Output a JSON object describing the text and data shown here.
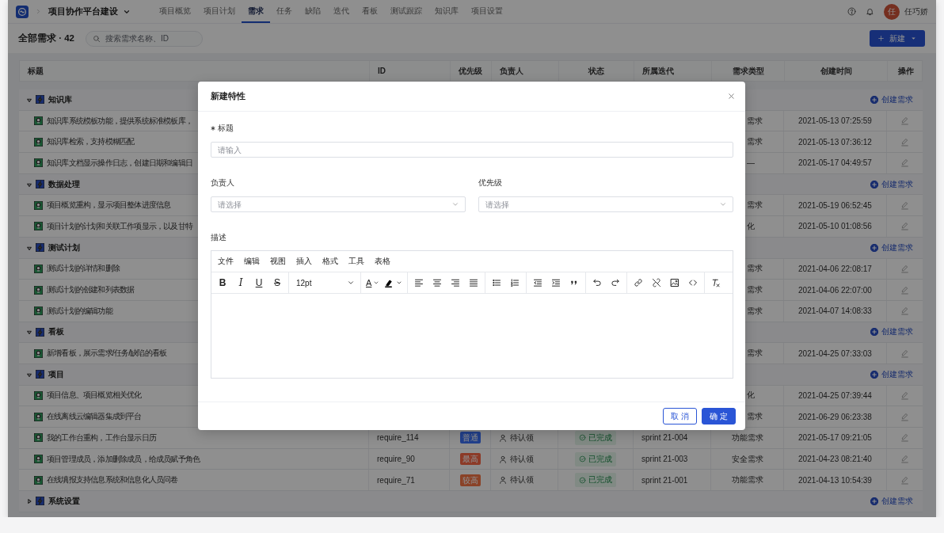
{
  "top_nav": {
    "project": "项目协作平台建设",
    "tabs": [
      {
        "label": "项目概览",
        "selected": false
      },
      {
        "label": "项目计划",
        "selected": false
      },
      {
        "label": "需求",
        "selected": true
      },
      {
        "label": "任务",
        "selected": false
      },
      {
        "label": "缺陷",
        "selected": false
      },
      {
        "label": "迭代",
        "selected": false
      },
      {
        "label": "看板",
        "selected": false
      },
      {
        "label": "测试跟踪",
        "selected": false
      },
      {
        "label": "知识库",
        "selected": false
      },
      {
        "label": "项目设置",
        "selected": false
      }
    ],
    "user": {
      "avatar_text": "任",
      "name": "任巧娇"
    }
  },
  "page_header": {
    "title": "全部需求 · 42",
    "search": {
      "placeholder": "搜索需求名称、ID"
    },
    "new_button": "新建"
  },
  "table": {
    "columns": [
      "标题",
      "ID",
      "优先级",
      "负责人",
      "状态",
      "所属迭代",
      "需求类型",
      "创建时间",
      "操作"
    ],
    "groups": [
      {
        "name": "知识库",
        "expanded": true,
        "action": "创建需求",
        "rows": [
          {
            "title": "知识库系统模板功能，提供系统标准模板库，",
            "type": "需求",
            "created": "2021-05-13 07:25:59"
          },
          {
            "title": "知识库检索，支持模糊匹配",
            "type": "需求",
            "created": "2021-05-13 07:36:12"
          },
          {
            "title": "知识库文档显示操作日志，创建日期和编辑日",
            "type": "—",
            "created": "2021-05-17 04:49:57"
          }
        ]
      },
      {
        "name": "数据处理",
        "expanded": true,
        "action": "创建需求",
        "rows": [
          {
            "title": "项目概览重构，显示项目整体进度信息",
            "type": "需求",
            "created": "2021-05-19 06:52:45"
          },
          {
            "title": "项目计划的计划和关联工作项显示，以及甘特",
            "type": "化",
            "created": "2021-05-10 01:08:56"
          }
        ]
      },
      {
        "name": "测试计划",
        "expanded": true,
        "action": "创建需求",
        "rows": [
          {
            "title": "测试计划的详情和删除",
            "type": "需求",
            "created": "2021-04-06 22:08:17"
          },
          {
            "title": "测试计划的创建和列表数据",
            "type": "需求",
            "created": "2021-04-06 22:07:00"
          },
          {
            "title": "测试计划的编辑功能",
            "type": "需求",
            "created": "2021-04-07 14:08:33"
          }
        ]
      },
      {
        "name": "看板",
        "expanded": true,
        "action": "创建需求",
        "rows": [
          {
            "title": "新增看板，展示需求/任务/缺陷的看板",
            "type": "需求",
            "created": "2021-04-25 07:33:03"
          }
        ]
      },
      {
        "name": "项目",
        "expanded": true,
        "action": "创建需求",
        "rows": [
          {
            "title": "项目信息、项目概览相关优化",
            "type": "化",
            "created": "2021-04-25 07:39:44"
          },
          {
            "title": "在线离线云编辑器集成到平台",
            "type": "需求",
            "created": "2021-06-29 06:23:38"
          },
          {
            "title": "我的工作台重构，工作台显示日历",
            "id": "require_114",
            "priority": {
              "label": "普通",
              "color": "#22408c"
            },
            "owner": "待认领",
            "status": "已完成",
            "sprint": "sprint 21-004",
            "type": "功能需求",
            "created": "2021-05-17 09:21:05"
          },
          {
            "title": "项目管理成员，添加删除成员，给成员赋予角色",
            "id": "require_90",
            "priority": {
              "label": "最高",
              "color": "#8c3a28"
            },
            "owner": "待认领",
            "status": "已完成",
            "sprint": "sprint 21-003",
            "type": "安全需求",
            "created": "2021-04-23 08:21:40"
          },
          {
            "title": "在线填报支持信息系统和信息化人员问卷",
            "id": "require_71",
            "priority": {
              "label": "较高",
              "color": "#8a4228"
            },
            "owner": "待认领",
            "status": "已完成",
            "sprint": "sprint 21-001",
            "type": "功能需求",
            "created": "2021-04-13 10:54:39"
          }
        ]
      },
      {
        "name": "系统设置",
        "expanded": false,
        "action": "创建需求"
      }
    ]
  },
  "modal": {
    "title": "新建特性",
    "fields": [
      {
        "kind": "input",
        "label": "标题",
        "required": true,
        "placeholder": "请输入"
      },
      {
        "kind": "select",
        "label": "负责人",
        "required": false,
        "placeholder": "请选择"
      },
      {
        "kind": "select",
        "label": "优先级",
        "required": false,
        "placeholder": "请选择"
      },
      {
        "kind": "editor",
        "label": "描述",
        "required": false
      }
    ],
    "editor": {
      "menus": [
        "文件",
        "编辑",
        "视图",
        "插入",
        "格式",
        "工具",
        "表格"
      ],
      "toolbar": [
        [
          {
            "kind": "bold",
            "glyph": "B"
          },
          {
            "kind": "italic",
            "glyph": "I"
          },
          {
            "kind": "underline",
            "glyph": "U"
          },
          {
            "kind": "strike",
            "glyph": "S"
          }
        ],
        [
          {
            "kind": "font-size",
            "value": "12pt"
          }
        ],
        [
          {
            "kind": "text-color",
            "glyph": "A"
          },
          {
            "kind": "highlight"
          }
        ],
        [
          {
            "kind": "align-left"
          },
          {
            "kind": "align-center"
          },
          {
            "kind": "align-right"
          },
          {
            "kind": "justify"
          }
        ],
        [
          {
            "kind": "bullet-list"
          },
          {
            "kind": "numbered-list"
          }
        ],
        [
          {
            "kind": "outdent"
          },
          {
            "kind": "indent"
          },
          {
            "kind": "quote"
          }
        ],
        [
          {
            "kind": "undo"
          },
          {
            "kind": "redo"
          }
        ],
        [
          {
            "kind": "link"
          },
          {
            "kind": "unlink"
          },
          {
            "kind": "image"
          },
          {
            "kind": "code"
          }
        ],
        [
          {
            "kind": "clear-format"
          }
        ]
      ]
    },
    "buttons": [
      {
        "label": "取 消",
        "kind": "secondary"
      },
      {
        "label": "确 定",
        "kind": "primary"
      }
    ]
  }
}
